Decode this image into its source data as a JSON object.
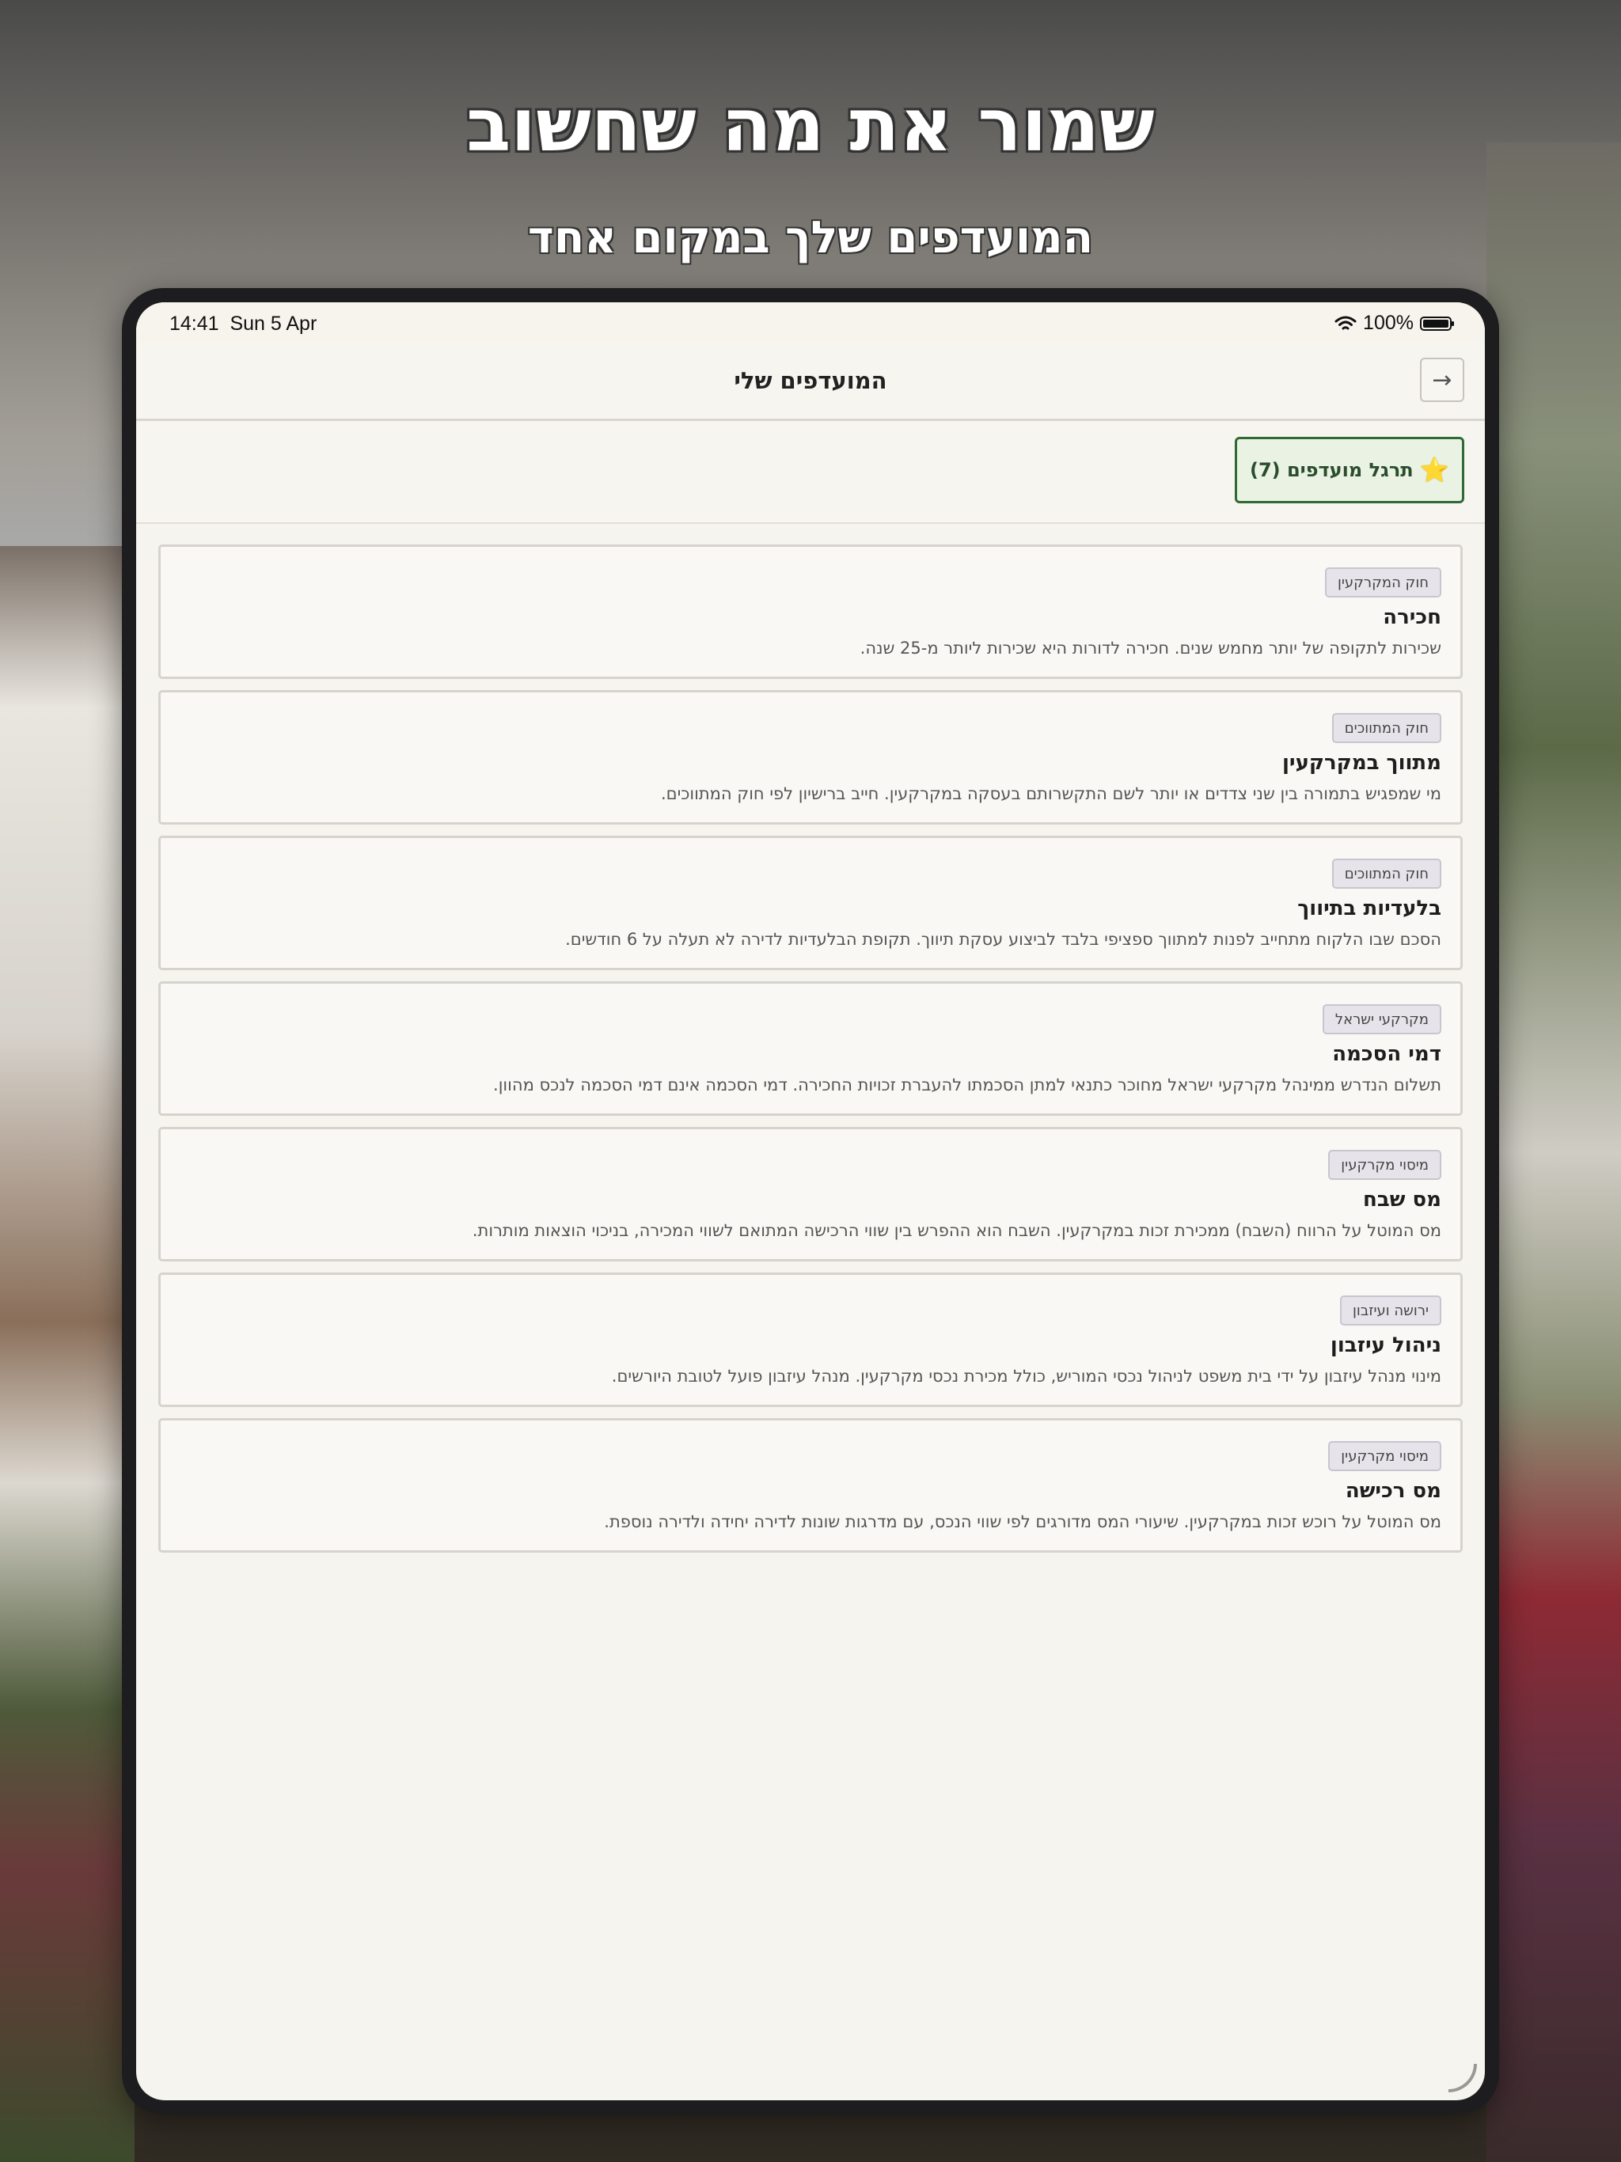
{
  "hero": {
    "title": "שמור את מה שחשוב",
    "subtitle": "המועדפים שלך במקום אחד"
  },
  "status_bar": {
    "time": "14:41",
    "date": "Sun 5 Apr",
    "battery": "100%",
    "icons": [
      "wifi-icon",
      "battery-icon"
    ]
  },
  "nav": {
    "title": "המועדפים שלי",
    "back_icon": "→"
  },
  "practice_button": {
    "star": "⭐",
    "label": "תרגל מועדפים (7)"
  },
  "favorites": [
    {
      "tag": "חוק המקרקעין",
      "term": "חכירה",
      "definition": "שכירות לתקופה של יותר מחמש שנים. חכירה לדורות היא שכירות ליותר מ-25 שנה."
    },
    {
      "tag": "חוק המתווכים",
      "term": "מתווך במקרקעין",
      "definition": "מי שמפגיש בתמורה בין שני צדדים או יותר לשם התקשרותם בעסקה במקרקעין. חייב ברישיון לפי חוק המתווכים."
    },
    {
      "tag": "חוק המתווכים",
      "term": "בלעדיות בתיווך",
      "definition": "הסכם שבו הלקוח מתחייב לפנות למתווך ספציפי בלבד לביצוע עסקת תיווך. תקופת הבלעדיות לדירה לא תעלה על 6 חודשים."
    },
    {
      "tag": "מקרקעי ישראל",
      "term": "דמי הסכמה",
      "definition": "תשלום הנדרש ממינהל מקרקעי ישראל מחוכר כתנאי למתן הסכמתו להעברת זכויות החכירה. דמי הסכמה אינם דמי הסכמה לנכס מהוון."
    },
    {
      "tag": "מיסוי מקרקעין",
      "term": "מס שבח",
      "definition": "מס המוטל על הרווח (השבח) ממכירת זכות במקרקעין. השבח הוא ההפרש בין שווי הרכישה המתואם לשווי המכירה, בניכוי הוצאות מותרות."
    },
    {
      "tag": "ירושה ועיזבון",
      "term": "ניהול עיזבון",
      "definition": "מינוי מנהל עיזבון על ידי בית משפט לניהול נכסי המוריש, כולל מכירת נכסי מקרקעין. מנהל עיזבון פועל לטובת היורשים."
    },
    {
      "tag": "מיסוי מקרקעין",
      "term": "מס רכישה",
      "definition": "מס המוטל על רוכש זכות במקרקעין. שיעורי המס מדורגים לפי שווי הנכס, עם מדרגות שונות לדירה יחידה ולדירה נוספת."
    }
  ]
}
